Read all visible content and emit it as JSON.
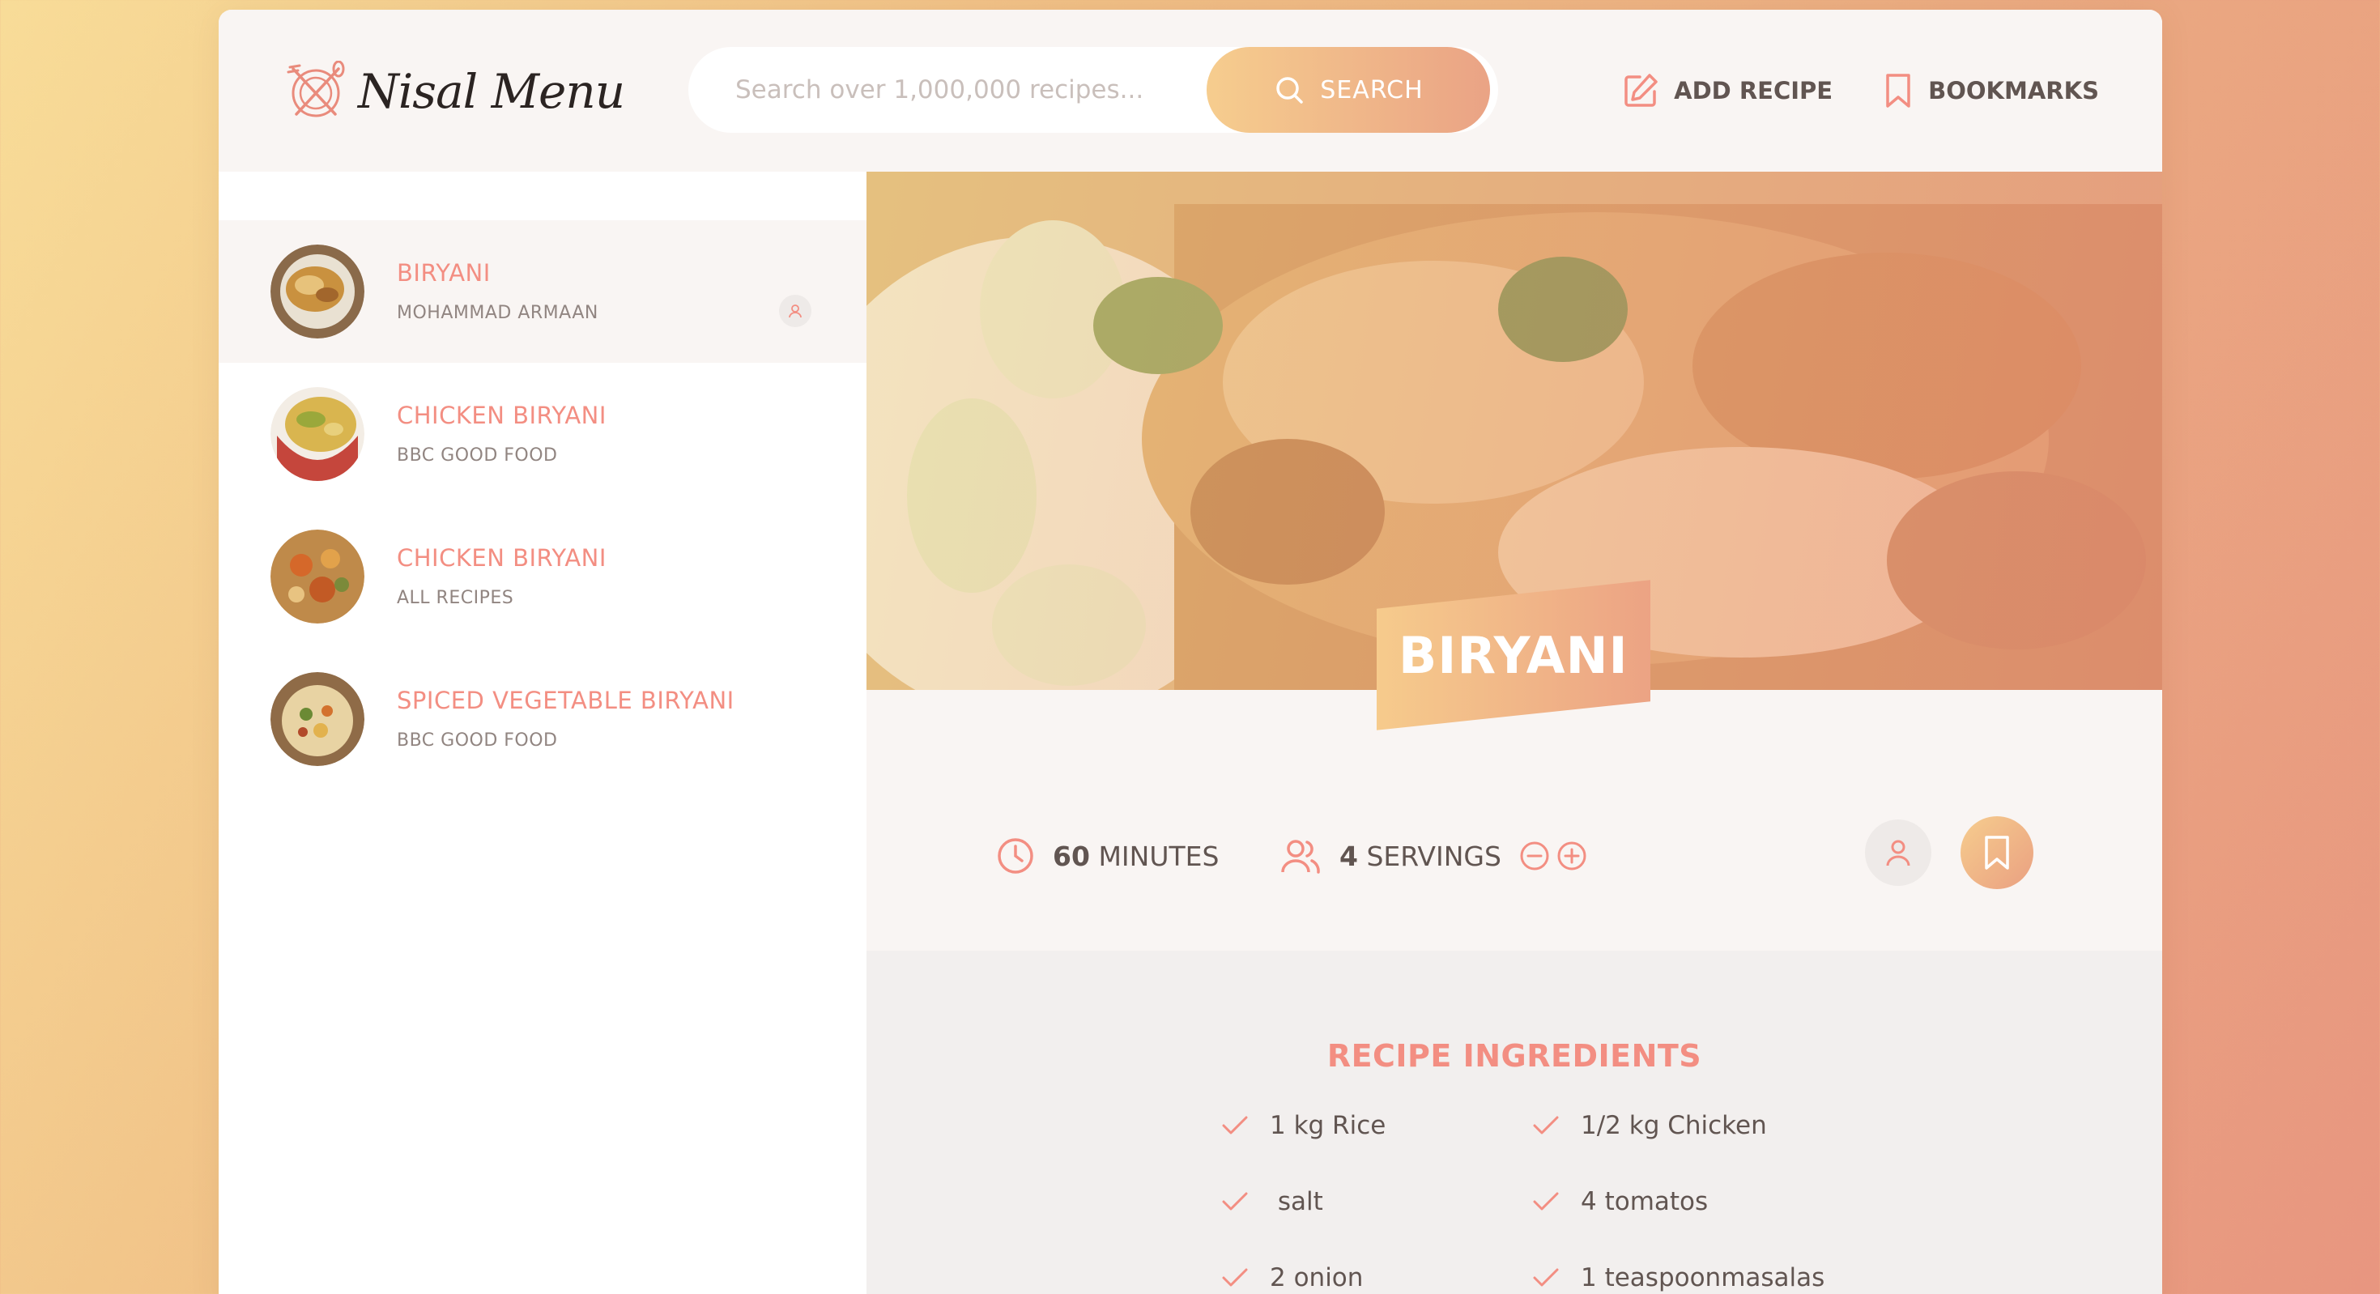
{
  "header": {
    "logo_text": "Nisal Menu",
    "search_placeholder": "Search over 1,000,000 recipes...",
    "search_button": "SEARCH",
    "nav": {
      "add_recipe": "ADD RECIPE",
      "bookmarks": "BOOKMARKS"
    }
  },
  "results": [
    {
      "title": "BIRYANI",
      "publisher": "MOHAMMAD ARMAAN",
      "active": true,
      "user_generated": true
    },
    {
      "title": "CHICKEN BIRYANI",
      "publisher": "BBC GOOD FOOD"
    },
    {
      "title": "CHICKEN BIRYANI",
      "publisher": "ALL RECIPES"
    },
    {
      "title": "SPICED VEGETABLE BIRYANI",
      "publisher": "BBC GOOD FOOD"
    }
  ],
  "recipe": {
    "title": "BIRYANI",
    "time_value": "60",
    "time_unit": "MINUTES",
    "servings_value": "4",
    "servings_unit": "SERVINGS",
    "ingredients_heading": "RECIPE INGREDIENTS",
    "ingredients": [
      "1 kg Rice",
      "1/2 kg Chicken",
      " salt",
      "4 tomatos",
      "2 onion",
      "1 teaspoonmasalas"
    ]
  },
  "colors": {
    "accent": "#f38e82",
    "gradient_start": "#fbdb89",
    "gradient_end": "#f48982",
    "text": "#615551"
  }
}
